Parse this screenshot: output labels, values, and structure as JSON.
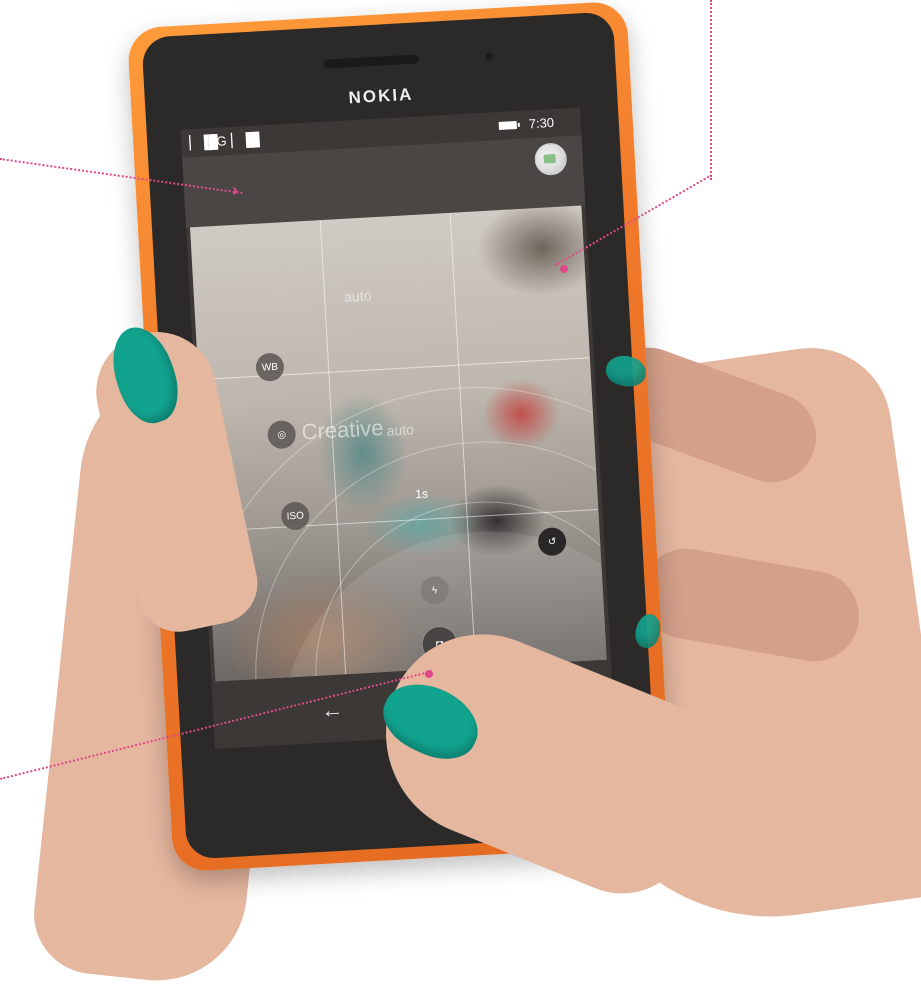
{
  "device": {
    "brand": "NOKIA"
  },
  "status_bar": {
    "signal_1": " ▏▐█",
    "network": "3G",
    "signal_2": "▏▐█",
    "time": "7:30"
  },
  "camera_ui": {
    "wb_label": "WB",
    "iso_label": "ISO",
    "shutter_speed": "1s",
    "auto_top": "auto",
    "auto_mid": "auto",
    "scene_text": "Creative"
  },
  "navigation": {
    "back": "←"
  },
  "colors": {
    "phone_orange": "#f0782a",
    "annotation_pink": "#e04a88",
    "nail_teal": "#12a38f"
  },
  "icons": [
    "signal-icon",
    "battery-icon",
    "profile-avatar",
    "back-arrow-icon",
    "camera-shutter-icon",
    "focus-icon",
    "exposure-icon",
    "flash-icon"
  ]
}
